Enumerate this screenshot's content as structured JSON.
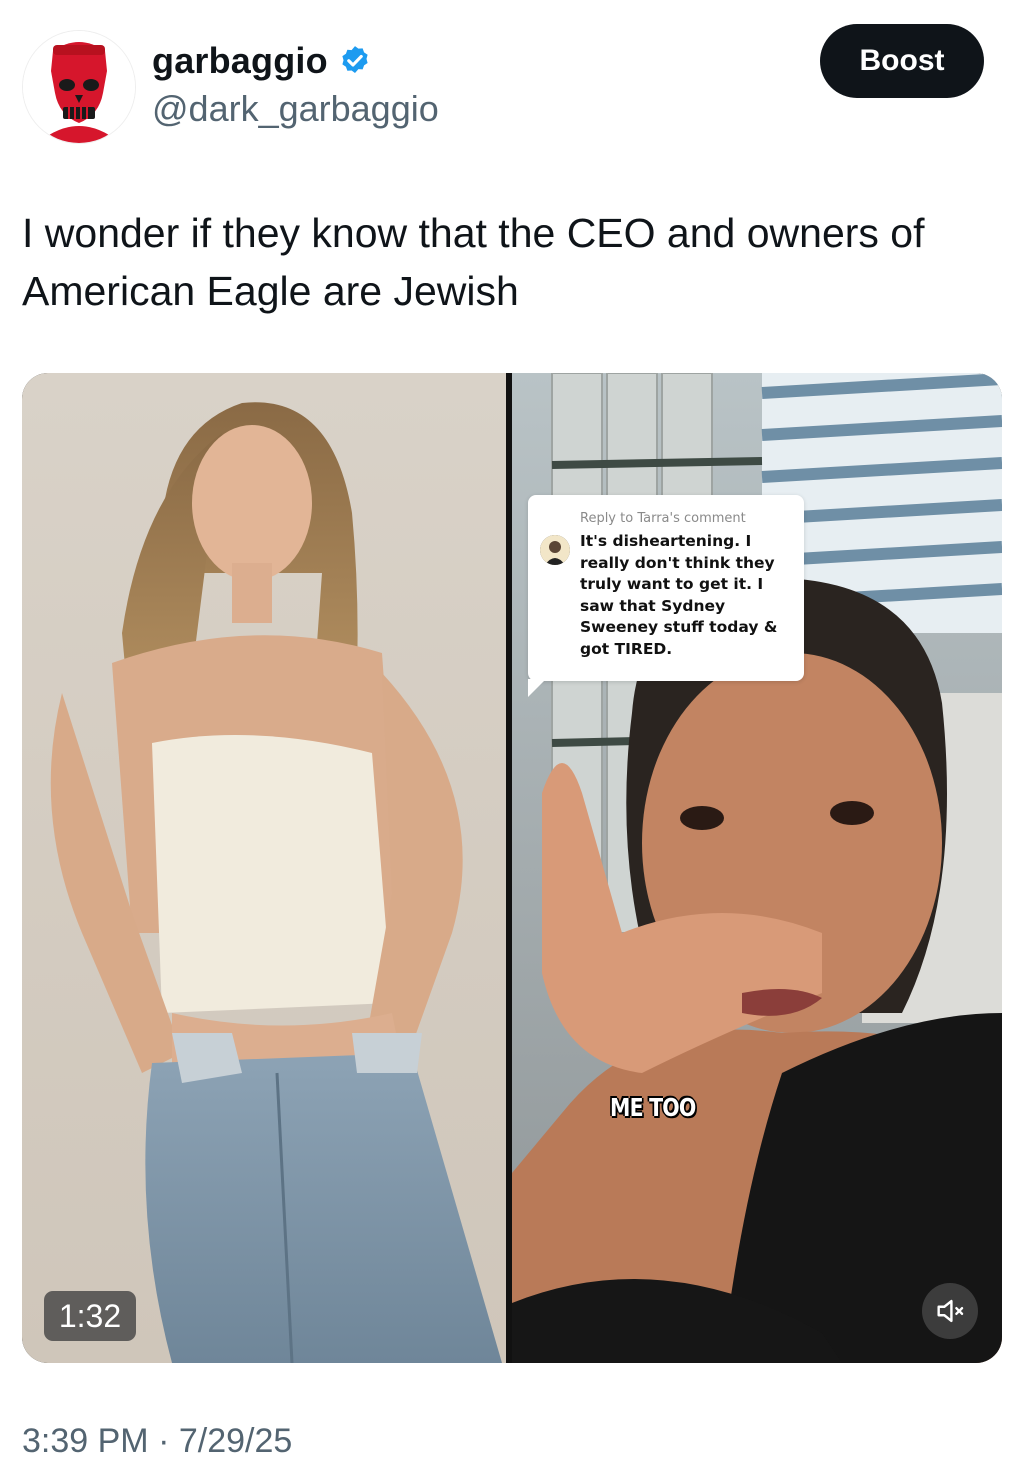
{
  "author": {
    "display_name": "garbaggio",
    "handle": "@dark_garbaggio",
    "verified_icon": "verified-badge-icon",
    "avatar_icon": "red-skull-avatar",
    "verified_color": "#1d9bf0"
  },
  "actions": {
    "boost_label": "Boost"
  },
  "post": {
    "text": "I wonder if they know that the CEO and owners of American Eagle are Jewish",
    "timestamp": "3:39 PM · 7/29/25"
  },
  "video": {
    "duration": "1:32",
    "mute_icon": "speaker-muted-icon",
    "comment_header": "Reply to Tarra's comment",
    "comment_text": "It's disheartening. I really don't think they truly want to get it. I saw that Sydney Sweeney stuff today & got TIRED.",
    "caption": "ME TOO"
  }
}
